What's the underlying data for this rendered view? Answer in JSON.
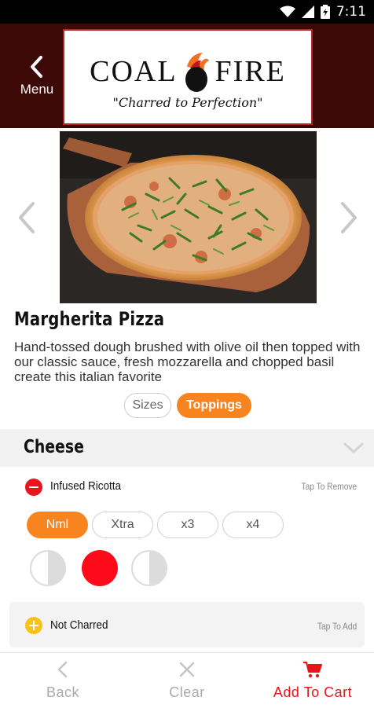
{
  "status_bar": {
    "time": "7:11",
    "icons": [
      "wifi-icon",
      "signal-icon",
      "battery-icon"
    ]
  },
  "header": {
    "menu_label": "Menu",
    "logo_left": "COAL",
    "logo_right": "FIRE",
    "logo_tagline": "\"Charred to Perfection\""
  },
  "product": {
    "name": "Margherita Pizza",
    "description": "Hand-tossed dough brushed with olive oil then topped with our classic sauce, fresh mozzarella and chopped basil create this italian favorite"
  },
  "tabs": [
    {
      "label": "Sizes",
      "selected": false
    },
    {
      "label": "Toppings",
      "selected": true
    }
  ],
  "category": {
    "title": "Cheese"
  },
  "topping": {
    "name": "Infused Ricotta",
    "hint": "Tap To Remove",
    "amounts": [
      {
        "label": "Nml",
        "selected": true
      },
      {
        "label": "Xtra",
        "selected": false
      },
      {
        "label": "x3",
        "selected": false
      },
      {
        "label": "x4",
        "selected": false
      }
    ],
    "placement": [
      "left-half",
      "whole",
      "right-half"
    ],
    "placement_selected": "whole"
  },
  "option": {
    "name": "Not Charred",
    "hint": "Tap To Add"
  },
  "bottom_bar": {
    "back_label": "Back",
    "clear_label": "Clear",
    "cart_label": "Add To Cart"
  },
  "colors": {
    "header_bg": "#3d0907",
    "accent_orange": "#f7841e",
    "accent_red": "#e8161b",
    "add_yellow": "#f7c21a"
  }
}
